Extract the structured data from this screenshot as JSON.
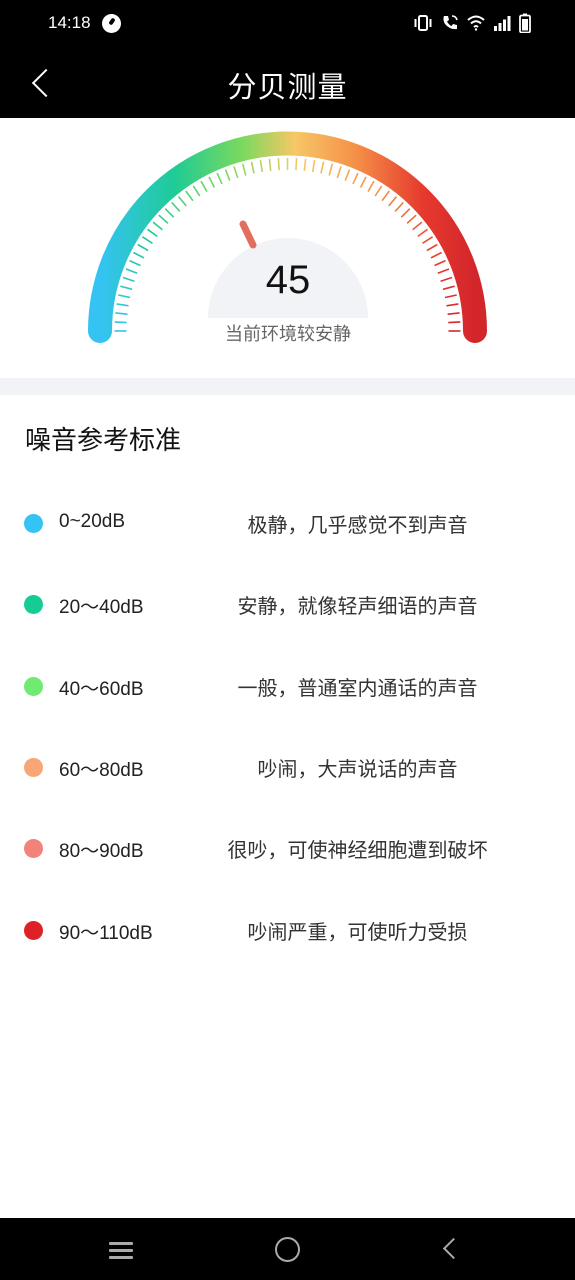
{
  "status_bar": {
    "time": "14:18",
    "icons": [
      "speed-indicator-icon",
      "vibrate-icon",
      "wifi-calling-icon",
      "wifi-icon",
      "signal-icon",
      "battery-icon"
    ]
  },
  "app_bar": {
    "title": "分贝测量",
    "back_icon": "chevron-left-icon"
  },
  "gauge": {
    "value": "45",
    "caption": "当前环境较安静",
    "colors": [
      "#35c3f3",
      "#1fcb95",
      "#7cd95e",
      "#f7c766",
      "#f59148",
      "#e63a2e",
      "#d3262b"
    ]
  },
  "reference": {
    "title": "噪音参考标准",
    "items": [
      {
        "range": "0~20dB",
        "description": "极静，几乎感觉不到声音",
        "color": "#35c3f3"
      },
      {
        "range": "20～40dB",
        "description": "安静，就像轻声细语的声音",
        "color": "#16cc95"
      },
      {
        "range": "40～60dB",
        "description": "一般，普通室内通话的声音",
        "color": "#70ea70"
      },
      {
        "range": "60～80dB",
        "description": "吵闹，大声说话的声音",
        "color": "#f8a674"
      },
      {
        "range": "80～90dB",
        "description": "很吵，可使神经细胞遭到破坏",
        "color": "#f28378"
      },
      {
        "range": "90～110dB",
        "description": "吵闹严重，可使听力受损",
        "color": "#de2126"
      }
    ]
  },
  "nav_bar": {
    "icons": [
      "menu-icon",
      "home-circle-icon",
      "back-triangle-icon"
    ]
  }
}
